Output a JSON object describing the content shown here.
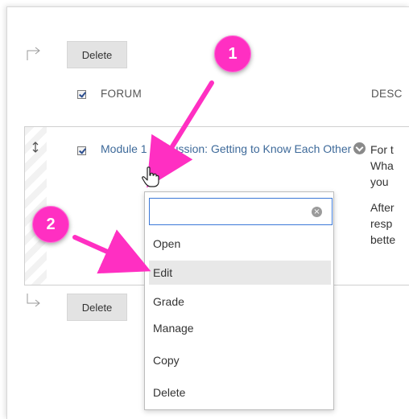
{
  "toolbar": {
    "delete_label": "Delete"
  },
  "table": {
    "columns": [
      "FORUM",
      "DESC"
    ],
    "row": {
      "forum_title": "Module 1 Discussion: Getting to Know Each Other",
      "description_lines": [
        "For t",
        "Wha",
        "you",
        "After",
        "resp",
        "bette"
      ]
    }
  },
  "context_menu": {
    "search_value": "",
    "items": [
      "Open",
      "Edit",
      "Grade",
      "Manage",
      "Copy",
      "Delete"
    ],
    "hovered_item": "Edit"
  },
  "annotations": [
    "1",
    "2"
  ],
  "colors": {
    "annotation": "#ff2fc2",
    "link": "#3e6a9a",
    "focus_border": "#3b78d8"
  },
  "icons": [
    "move-handle-icon",
    "chevron-down-circle-icon",
    "hand-cursor-icon",
    "clear-icon",
    "connector-arrow-icon"
  ]
}
